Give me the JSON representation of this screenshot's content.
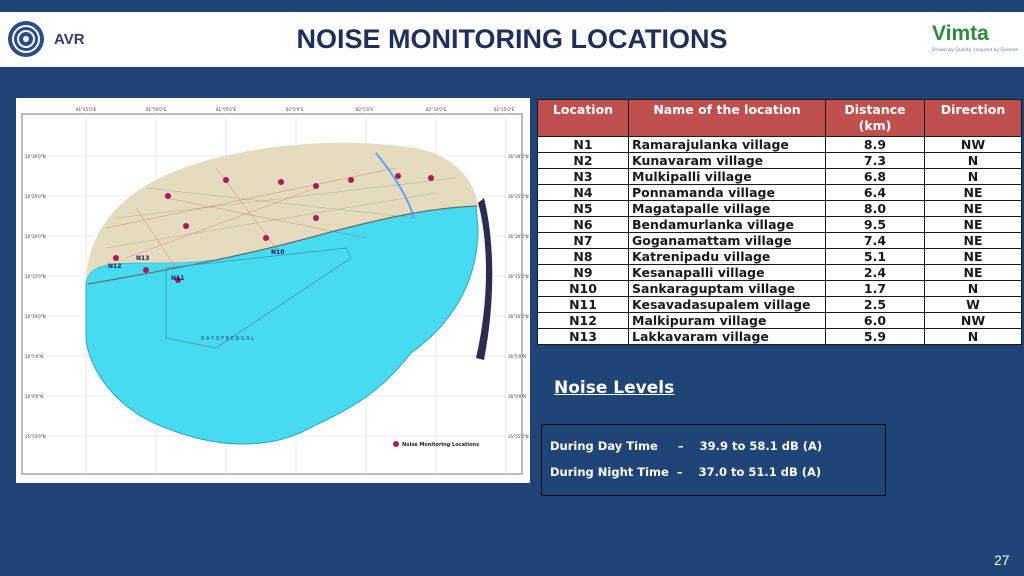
{
  "header": {
    "title": "NOISE MONITORING LOCATIONS",
    "left_logo_text": "AVR",
    "right_logo_text": "Vimta",
    "right_logo_tagline": "Driven by Quality, Inspired by Science"
  },
  "map": {
    "legend_label": "Noise Monitoring Locations",
    "sea_label": "B A Y   O F   B E N G A L",
    "point_labels": [
      "N10",
      "N11",
      "N12",
      "N13"
    ],
    "top_ticks": [
      "81°45'0\"E",
      "81°50'0\"E",
      "81°55'0\"E",
      "82°0'0\"E",
      "82°5'0\"E",
      "82°10'0\"E",
      "82°15'0\"E"
    ],
    "side_ticks": [
      "16°30'0\"N",
      "16°25'0\"N",
      "16°20'0\"N",
      "16°15'0\"N",
      "16°10'0\"N",
      "16°5'0\"N",
      "16°0'0\"N",
      "15°55'0\"N"
    ],
    "colors": {
      "sea": "#46dbf0",
      "land": "#e5dcc0",
      "points": "#b0175a"
    }
  },
  "table": {
    "headers": [
      "Location",
      "Name of the location",
      "Distance (km)",
      "Direction"
    ],
    "rows": [
      [
        "N1",
        "Ramarajulanka village",
        "8.9",
        "NW"
      ],
      [
        "N2",
        "Kunavaram village",
        "7.3",
        "N"
      ],
      [
        "N3",
        "Mulkipalli village",
        "6.8",
        "N"
      ],
      [
        "N4",
        "Ponnamanda village",
        "6.4",
        "NE"
      ],
      [
        "N5",
        "Magatapalle village",
        "8.0",
        "NE"
      ],
      [
        "N6",
        "Bendamurlanka village",
        "9.5",
        "NE"
      ],
      [
        "N7",
        "Goganamattam village",
        "7.4",
        "NE"
      ],
      [
        "N8",
        "Katrenipadu village",
        "5.1",
        "NE"
      ],
      [
        "N9",
        "Kesanapalli village",
        "2.4",
        "NE"
      ],
      [
        "N10",
        "Sankaraguptam village",
        "1.7",
        "N"
      ],
      [
        "N11",
        "Kesavadasupalem village",
        "2.5",
        "W"
      ],
      [
        "N12",
        "Malkipuram village",
        "6.0",
        "NW"
      ],
      [
        "N13",
        "Lakkavaram village",
        "5.9",
        "N"
      ]
    ]
  },
  "noise": {
    "title": "Noise Levels",
    "day": "During Day Time     –    39.9 to 58.1 dB (A)",
    "night": "During Night Time  –    37.0 to 51.1 dB (A)"
  },
  "footer": {
    "page_number": "27"
  },
  "colors": {
    "background": "#1f4577",
    "table_header": "#c0504d",
    "title": "#1f2f5c"
  }
}
